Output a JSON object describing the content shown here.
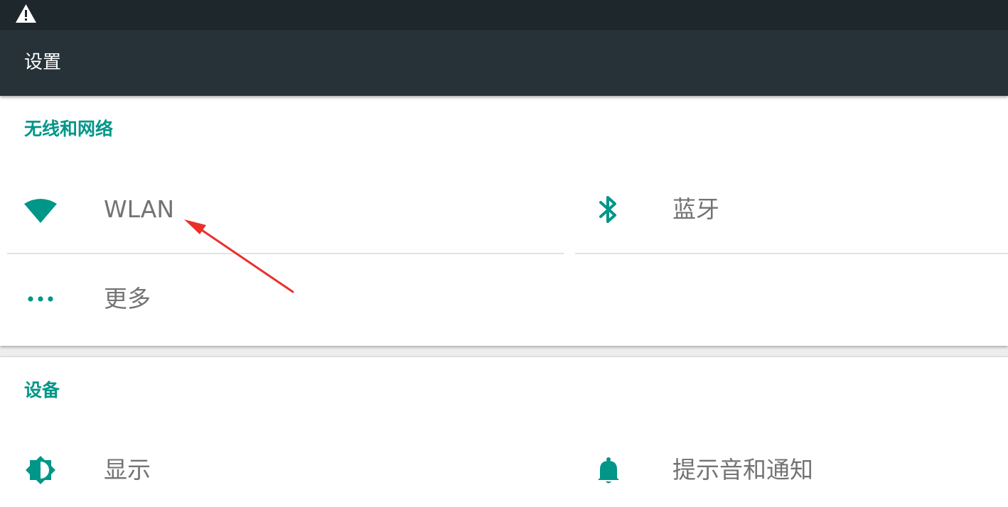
{
  "status_bar": {
    "icons": [
      "warning-icon"
    ]
  },
  "app_bar": {
    "title": "设置"
  },
  "sections": [
    {
      "header": "无线和网络",
      "items": [
        {
          "label": "WLAN",
          "icon": "wifi-icon"
        },
        {
          "label": "蓝牙",
          "icon": "bluetooth-icon"
        },
        {
          "label": "更多",
          "icon": "more-horiz-icon"
        }
      ]
    },
    {
      "header": "设备",
      "items": [
        {
          "label": "显示",
          "icon": "brightness-icon"
        },
        {
          "label": "提示音和通知",
          "icon": "bell-icon"
        }
      ]
    }
  ],
  "annotation": {
    "type": "arrow",
    "color": "#e8312b",
    "points_to": "WLAN"
  },
  "colors": {
    "accent": "#009688",
    "app_bar": "#263238",
    "status_bar": "#1e272c",
    "item_text": "#737373",
    "card": "#ffffff",
    "background": "#eeeeee"
  }
}
